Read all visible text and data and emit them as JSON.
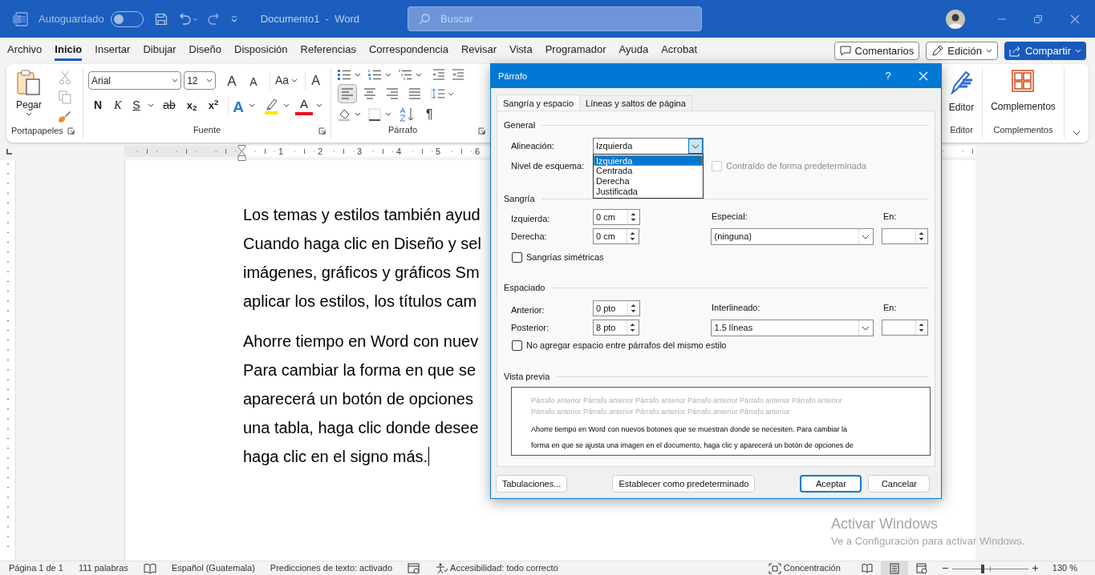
{
  "title_bar": {
    "autosave_label": "Autoguardado",
    "autosave_on": false,
    "title": "Documento1  -  Word",
    "search_placeholder": "Buscar"
  },
  "ribbon_tabs": [
    {
      "label": "Archivo",
      "selected": false
    },
    {
      "label": "Inicio",
      "selected": true
    },
    {
      "label": "Insertar",
      "selected": false
    },
    {
      "label": "Dibujar",
      "selected": false
    },
    {
      "label": "Diseño",
      "selected": false
    },
    {
      "label": "Disposición",
      "selected": false
    },
    {
      "label": "Referencias",
      "selected": false
    },
    {
      "label": "Correspondencia",
      "selected": false
    },
    {
      "label": "Revisar",
      "selected": false
    },
    {
      "label": "Vista",
      "selected": false
    },
    {
      "label": "Programador",
      "selected": false
    },
    {
      "label": "Ayuda",
      "selected": false
    },
    {
      "label": "Acrobat",
      "selected": false
    }
  ],
  "ribbon_actions": [
    {
      "label": "Comentarios",
      "kind": "comments"
    },
    {
      "label": "Edición",
      "kind": "editing"
    },
    {
      "label": "Compartir",
      "kind": "share"
    }
  ],
  "ribbon": {
    "paste_label": "Pegar",
    "clipboard_group": "Portapapeles",
    "font_name": "Arial",
    "font_size": "12",
    "font_row1": [
      {
        "kind": "grow",
        "label": "A"
      },
      {
        "kind": "shrink",
        "label": "A"
      },
      {
        "kind": "case",
        "label": "Aa"
      },
      {
        "kind": "clear",
        "label": "A"
      }
    ],
    "font_row2": [
      {
        "kind": "bold",
        "label": "N"
      },
      {
        "kind": "italic",
        "label": "K"
      },
      {
        "kind": "underline",
        "label": "S"
      },
      {
        "kind": "strike",
        "label": "ab"
      },
      {
        "kind": "sub",
        "label": "x$_{2}$"
      },
      {
        "kind": "sup",
        "label": "x$^{2}$"
      },
      {
        "kind": "effects",
        "label": "A"
      },
      {
        "kind": "highlight"
      },
      {
        "kind": "color",
        "label": "A"
      }
    ],
    "font_group": "Fuente",
    "alignment": [
      {
        "kind": "left",
        "selected": true
      },
      {
        "kind": "center",
        "selected": false
      },
      {
        "kind": "right",
        "selected": false
      },
      {
        "kind": "justify",
        "selected": false
      }
    ],
    "show_marks": "¶",
    "paragraph_group": "Párrafo",
    "editor_label": "Editor",
    "editor_group": "Editor",
    "addins_label": "Complementos",
    "addins_group": "Complementos"
  },
  "ruler_numbers": [
    "1",
    "2",
    "3",
    "4",
    "5",
    "6"
  ],
  "document": {
    "paragraphs": [
      {
        "lines": [
          "Los temas y estilos también ayud",
          "Cuando haga clic en Diseño y sel",
          "imágenes, gráficos y gráficos Sm",
          "aplicar los estilos, los títulos cam"
        ]
      },
      {
        "lines": [
          "Ahorre tiempo en Word con nuev",
          "Para cambiar la forma en que se",
          "aparecerá un botón de opciones",
          "una tabla, haga clic donde desee",
          "haga clic en el signo más."
        ]
      }
    ]
  },
  "dialog": {
    "title": "Párrafo",
    "help": "?",
    "tabs": [
      {
        "label": "Sangría y espacio",
        "selected": true
      },
      {
        "label": "Líneas y saltos de página",
        "selected": false
      }
    ],
    "general": {
      "heading": "General",
      "alignment_label": "Alineación:",
      "alignment_value": "Izquierda",
      "alignment_options": [
        {
          "label": "Izquierda",
          "selected": true
        },
        {
          "label": "Centrada",
          "selected": false
        },
        {
          "label": "Derecha",
          "selected": false
        },
        {
          "label": "Justificada",
          "selected": false
        }
      ],
      "outline_label": "Nivel de esquema:",
      "collapsed": {
        "label": "Contraído de forma predeterminada",
        "checked": false,
        "disabled": true
      }
    },
    "indent": {
      "heading": "Sangría",
      "left_label": "Izquierda:",
      "left_value": "0 cm",
      "right_label": "Derecha:",
      "right_value": "0 cm",
      "special_label": "Especial:",
      "special_value": "(ninguna)",
      "by_label": "En:",
      "mirror": {
        "label": "Sangrías simétricas",
        "checked": false
      }
    },
    "spacing": {
      "heading": "Espaciado",
      "before_label": "Anterior:",
      "before_value": "0 pto",
      "after_label": "Posterior:",
      "after_value": "8 pto",
      "line_label": "Interlineado:",
      "line_value": "1.5 líneas",
      "at_label": "En:",
      "no_space": {
        "label": "No agregar espacio entre párrafos del mismo estilo",
        "checked": false
      }
    },
    "preview": {
      "heading": "Vista previa",
      "previous_lines": [
        "Párrafo anterior Párrafo anterior Párrafo anterior Párrafo anterior Párrafo anterior Párrafo anterior",
        "Párrafo anterior Párrafo anterior Párrafo anterior Párrafo anterior Párrafo anterior"
      ],
      "sample_lines": [
        "Ahorre tiempo en Word con nuevos botones que se muestran donde se necesiten. Para cambiar la",
        "forma en que se ajusta una imagen en el documento, haga clic y aparecerá un botón de opciones de"
      ]
    },
    "buttons": [
      {
        "label": "Tabulaciones...",
        "default": false
      },
      {
        "label": "Establecer como predeterminado",
        "default": false
      },
      {
        "label": "Aceptar",
        "default": true
      },
      {
        "label": "Cancelar",
        "default": false
      }
    ]
  },
  "status_bar": {
    "items": [
      {
        "kind": "text",
        "label": "Página 1 de 1"
      },
      {
        "kind": "text",
        "label": "111 palabras"
      },
      {
        "kind": "proofing"
      },
      {
        "kind": "text",
        "label": "Español (Guatemala)"
      },
      {
        "kind": "text",
        "label": "Predicciones de texto: activado"
      },
      {
        "kind": "macro"
      },
      {
        "kind": "accessibility",
        "label": "Accesibilidad: todo correcto"
      }
    ],
    "focus_label": "Concentración",
    "views": [
      {
        "kind": "read",
        "selected": false
      },
      {
        "kind": "print",
        "selected": true
      },
      {
        "kind": "web",
        "selected": false
      }
    ],
    "zoom": {
      "level": 0.4,
      "reading": "130 %"
    }
  },
  "activation_notice": [
    "Activar Windows",
    "Ve a Configuración para activar Windows."
  ]
}
